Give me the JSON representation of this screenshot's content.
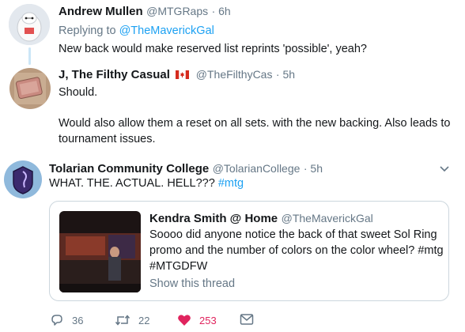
{
  "tweet1": {
    "name": "Andrew Mullen",
    "handle": "@MTGRaps",
    "time": "· 6h",
    "replying_prefix": "Replying to",
    "replying_to": "@TheMaverickGal",
    "text": "New back would make reserved list reprints 'possible', yeah?"
  },
  "tweet2": {
    "name": "J, The Filthy Casual",
    "flag": "🇨🇦",
    "handle": "@TheFilthyCas",
    "time": "· 5h",
    "text_line1": "Should.",
    "text_line2": "Would also allow them a reset on all sets. with the new backing. Also leads to",
    "text_line3": "tournament issues."
  },
  "tweet3": {
    "name": "Tolarian Community College",
    "handle": "@TolarianCollege",
    "time": "· 5h",
    "text": "WHAT. THE. ACTUAL. HELL???",
    "hashtag": "#mtg",
    "quote": {
      "name": "Kendra Smith @ Home",
      "handle": "@TheMaverickGal",
      "text_line1": "Soooo did anyone notice the back of that sweet Sol Ring",
      "text_line2": "promo and the number of colors on the color wheel? #mtg",
      "text_line3": "#MTGDFW",
      "show_thread": "Show this thread"
    },
    "actions": {
      "replies": "36",
      "retweets": "22",
      "likes": "253"
    }
  },
  "colors": {
    "accent": "#1da1f2",
    "like": "#e0245e",
    "secondary_text": "#657786",
    "thread_line": "#cce6f7"
  }
}
